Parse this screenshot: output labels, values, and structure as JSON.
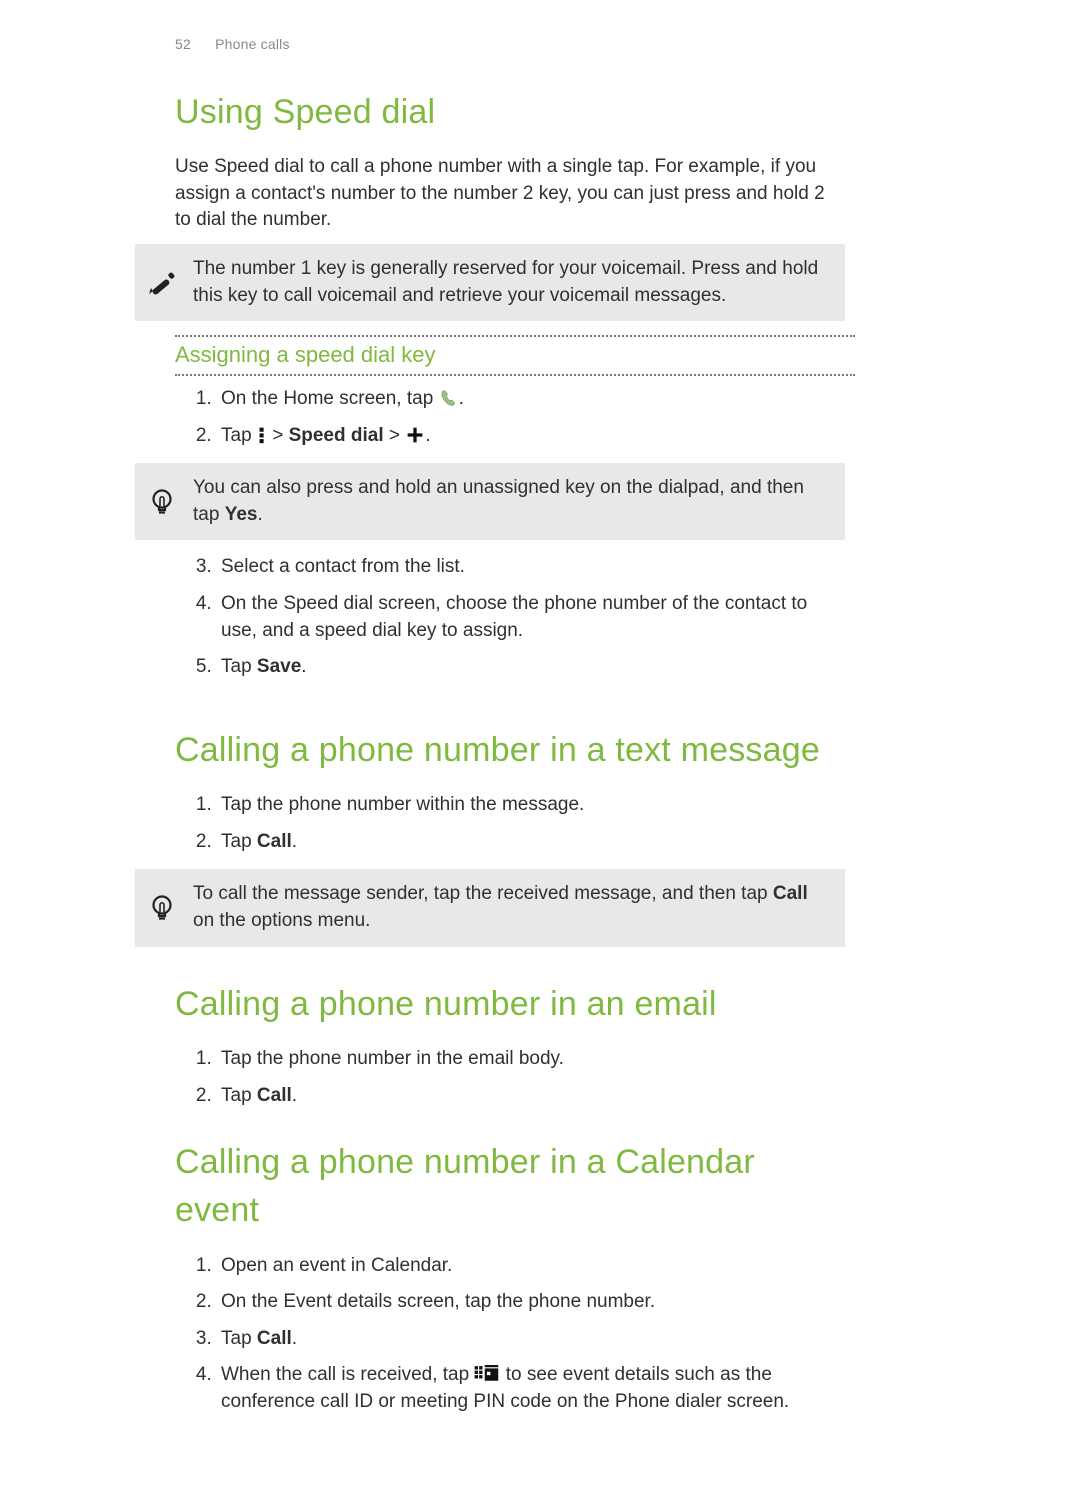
{
  "header": {
    "page_number": "52",
    "section": "Phone calls"
  },
  "s1": {
    "title": "Using Speed dial",
    "intro": "Use Speed dial to call a phone number with a single tap. For example, if you assign a contact's number to the number 2 key, you can just press and hold 2 to dial the number.",
    "note": "The number 1 key is generally reserved for your voicemail. Press and hold this key to call voicemail and retrieve your voicemail messages.",
    "sub_title": "Assigning a speed dial key",
    "step1_a": "On the Home screen, tap ",
    "step1_b": ".",
    "step2_a": "Tap ",
    "step2_b": " > ",
    "step2_label": "Speed dial",
    "step2_c": " > ",
    "step2_d": ".",
    "tip": "You can also press and hold an unassigned key on the dialpad, and then tap ",
    "tip_bold": "Yes",
    "tip_end": ".",
    "step3": "Select a contact from the list.",
    "step4": "On the Speed dial screen, choose the phone number of the contact to use, and a speed dial key to assign.",
    "step5_a": "Tap ",
    "step5_bold": "Save",
    "step5_b": "."
  },
  "s2": {
    "title": "Calling a phone number in a text message",
    "step1": "Tap the phone number within the message.",
    "step2_a": "Tap ",
    "step2_bold": "Call",
    "step2_b": ".",
    "tip_a": "To call the message sender, tap the received message, and then tap ",
    "tip_bold": "Call",
    "tip_b": " on the options menu."
  },
  "s3": {
    "title": "Calling a phone number in an email",
    "step1": "Tap the phone number in the email body.",
    "step2_a": "Tap ",
    "step2_bold": "Call",
    "step2_b": "."
  },
  "s4": {
    "title": "Calling a phone number in a Calendar event",
    "step1": "Open an event in Calendar.",
    "step2": "On the Event details screen, tap the phone number.",
    "step3_a": "Tap ",
    "step3_bold": "Call",
    "step3_b": ".",
    "step4_a": "When the call is received, tap ",
    "step4_b": " to see event details such as the conference call ID or meeting PIN code on the Phone dialer screen."
  }
}
